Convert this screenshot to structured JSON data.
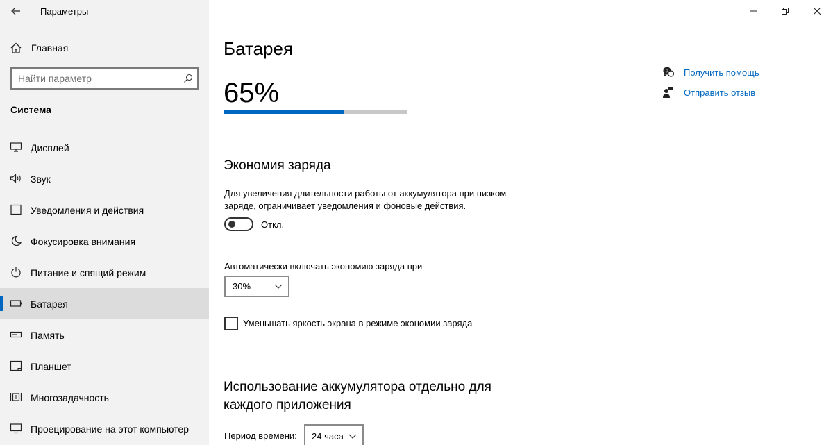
{
  "window": {
    "title": "Параметры"
  },
  "sidebar": {
    "home_label": "Главная",
    "search_placeholder": "Найти параметр",
    "group_title": "Система",
    "items": [
      {
        "label": "Дисплей",
        "icon": "display-icon"
      },
      {
        "label": "Звук",
        "icon": "speaker-icon"
      },
      {
        "label": "Уведомления и действия",
        "icon": "notifications-icon"
      },
      {
        "label": "Фокусировка внимания",
        "icon": "moon-icon"
      },
      {
        "label": "Питание и спящий режим",
        "icon": "power-icon"
      },
      {
        "label": "Батарея",
        "icon": "battery-icon",
        "active": true
      },
      {
        "label": "Память",
        "icon": "storage-icon"
      },
      {
        "label": "Планшет",
        "icon": "tablet-icon"
      },
      {
        "label": "Многозадачность",
        "icon": "multitasking-icon"
      },
      {
        "label": "Проецирование на этот компьютер",
        "icon": "projecting-icon"
      }
    ]
  },
  "main": {
    "title": "Батарея",
    "battery_percent_text": "65%",
    "battery_level": 0.65,
    "saver": {
      "title": "Экономия заряда",
      "description": "Для увеличения длительности работы от аккумулятора при низком заряде, ограничивает уведомления и фоновые действия.",
      "toggle_state": "Откл.",
      "auto_label": "Автоматически включать экономию заряда при",
      "auto_value": "30%",
      "brightness_label": "Уменьшать яркость экрана в режиме экономии заряда",
      "brightness_checked": false
    },
    "usage": {
      "title": "Использование аккумулятора отдельно для каждого приложения",
      "period_label": "Период времени:",
      "period_value": "24 часа"
    },
    "help": {
      "get_help": "Получить помощь",
      "send_feedback": "Отправить отзыв"
    }
  },
  "colors": {
    "accent": "#0067c0",
    "sidebar_bg": "#f2f2f2",
    "active_bg": "#dcdcdc"
  }
}
